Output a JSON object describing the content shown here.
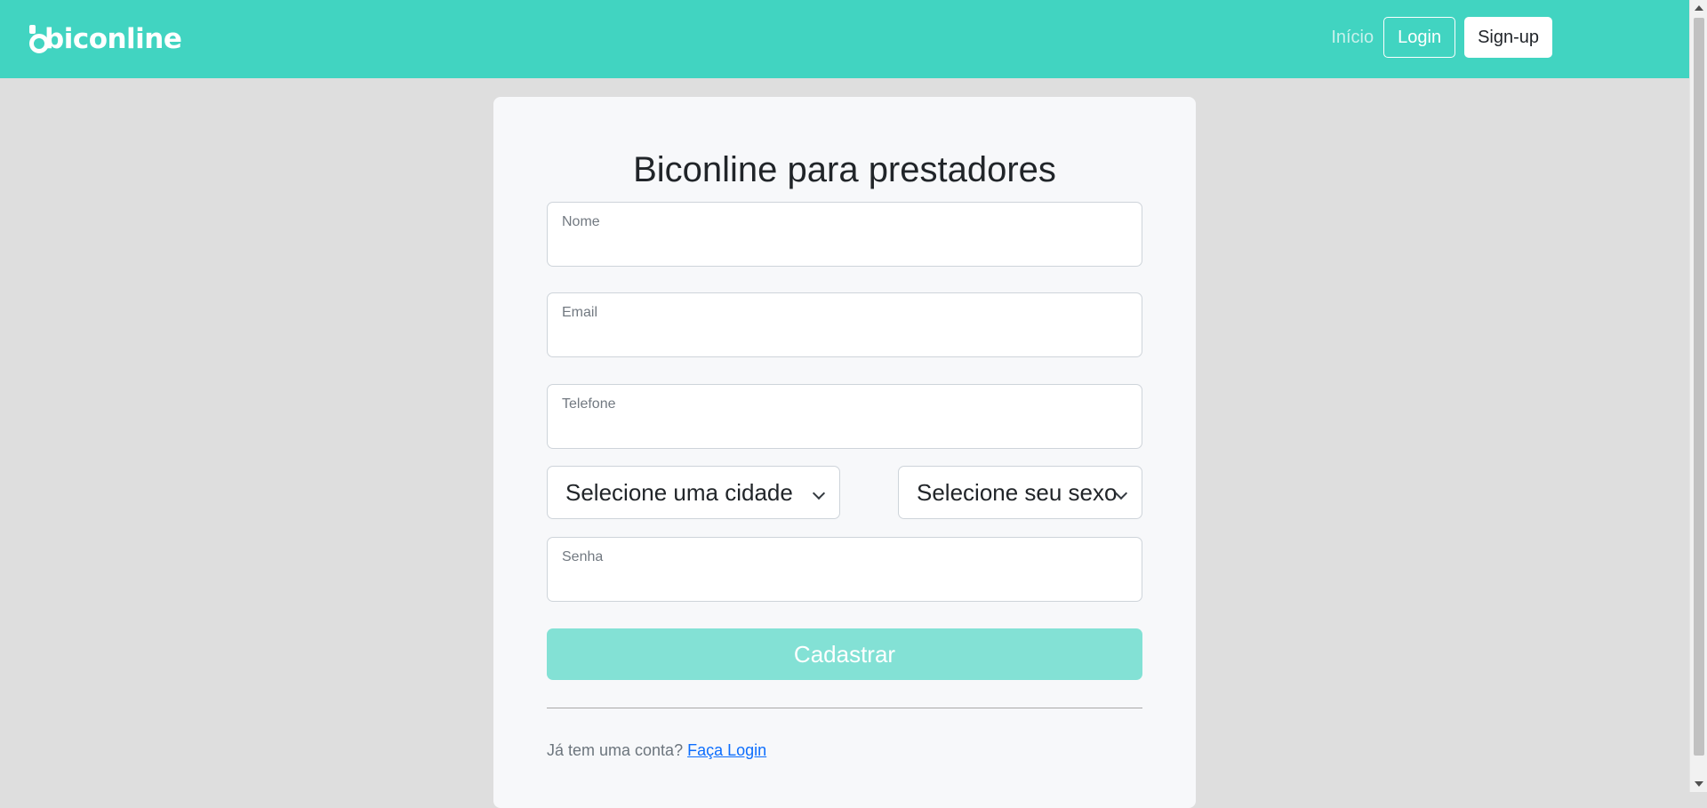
{
  "header": {
    "logo_text": "biconline",
    "nav_home": "Início",
    "login_label": "Login",
    "signup_label": "Sign-up"
  },
  "form": {
    "title": "Biconline para prestadores",
    "name_label": "Nome",
    "email_label": "Email",
    "phone_label": "Telefone",
    "city_select": "Selecione uma cidade",
    "sex_select": "Selecione seu sexo",
    "password_label": "Senha",
    "submit_label": "Cadastrar"
  },
  "footer": {
    "prompt_text": "Já tem uma conta?",
    "login_link": "Faça Login"
  },
  "colors": {
    "brand": "#41d4c1",
    "submit_disabled": "#83e1d5",
    "link": "#0d6efd"
  }
}
